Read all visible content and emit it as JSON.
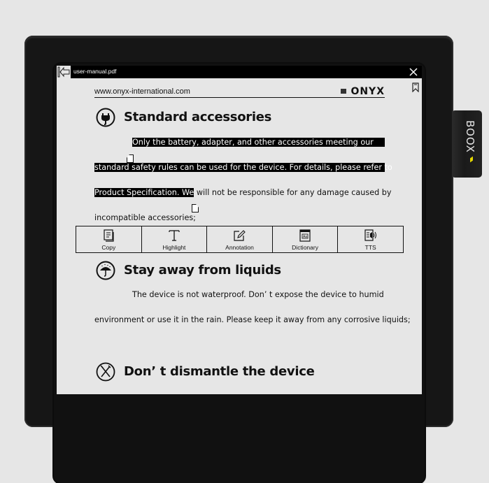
{
  "device": {
    "brand": "BOOX",
    "accent_color": "#e3d700"
  },
  "topbar": {
    "file_name": "user-manual.pdf"
  },
  "page": {
    "header_site": "www.onyx-international.com",
    "header_logo": "ONYX",
    "sections": [
      {
        "icon": "plug-icon",
        "title": "Standard accessories",
        "lines": [
          "Only  the  battery,  adapter,  and  other  accessories  meeting  our",
          "standard safety rules can be used for the device. For details, please refer to",
          "Product Specification. We",
          " will not be responsible for any damage caused by",
          "incompatible accessories;"
        ]
      },
      {
        "icon": "umbrella-rain-icon",
        "title": "Stay away from liquids",
        "lines": [
          "The device is not waterproof. Don’  t expose the device to humid",
          "environment or use it in the rain. Please keep it away from any corrosive liquids;"
        ]
      },
      {
        "icon": "no-tools-icon",
        "title": "Don’  t dismantle the device",
        "lines": []
      }
    ]
  },
  "selection_toolbar": {
    "items": [
      {
        "label": "Copy",
        "icon": "copy-icon"
      },
      {
        "label": "Highlight",
        "icon": "text-t-icon"
      },
      {
        "label": "Annotation",
        "icon": "pencil-edit-icon"
      },
      {
        "label": "Dictionary",
        "icon": "dictionary-icon"
      },
      {
        "label": "TTS",
        "icon": "speaker-icon"
      }
    ]
  }
}
